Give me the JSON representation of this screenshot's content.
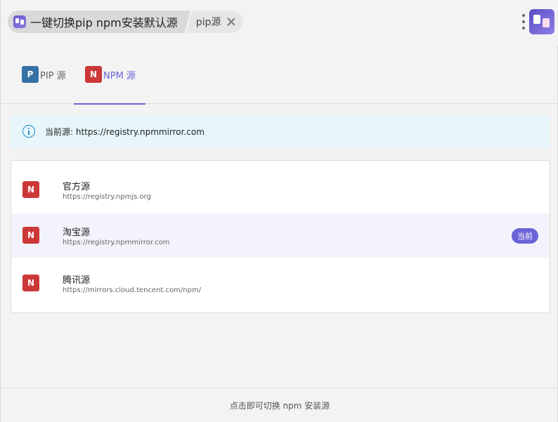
{
  "titlebar": {
    "app_title": "一键切换pip npm安装默认源",
    "tab_title": "pip源"
  },
  "tabs": [
    {
      "badge": "P",
      "label": "PIP 源",
      "active": false
    },
    {
      "badge": "N",
      "label": "NPM 源",
      "active": true
    }
  ],
  "info": {
    "text": "当前源: https://registry.npmmirror.com"
  },
  "sources": [
    {
      "badge": "N",
      "name": "官方源",
      "url": "https://registry.npmjs.org",
      "current": false
    },
    {
      "badge": "N",
      "name": "淘宝源",
      "url": "https://registry.npmmirror.com",
      "current": true,
      "tag": "当前"
    },
    {
      "badge": "N",
      "name": "腾讯源",
      "url": "https://mirrors.cloud.tencent.com/npm/",
      "current": false
    }
  ],
  "footer": {
    "hint": "点击即可切换 npm 安装源"
  },
  "colors": {
    "accent": "#6b63d8",
    "npm_red": "#cb3837",
    "pip_blue": "#3572a5",
    "info_bg": "#e6f6fb"
  }
}
